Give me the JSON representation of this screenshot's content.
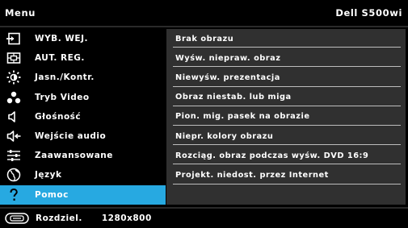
{
  "header": {
    "title": "Menu",
    "model": "Dell S500wi"
  },
  "menu": {
    "items": [
      {
        "label": "WYB. WEJ.",
        "icon": "input-source-icon"
      },
      {
        "label": "AUT. REG.",
        "icon": "auto-adjust-icon"
      },
      {
        "label": "Jasn./Kontr.",
        "icon": "brightness-icon"
      },
      {
        "label": "Tryb Video",
        "icon": "video-mode-icon"
      },
      {
        "label": "Głośność",
        "icon": "volume-icon"
      },
      {
        "label": "Wejście audio",
        "icon": "audio-input-icon"
      },
      {
        "label": "Zaawansowane",
        "icon": "advanced-settings-icon"
      },
      {
        "label": "Język",
        "icon": "language-globe-icon"
      },
      {
        "label": "Pomoc",
        "icon": "help-icon",
        "selected": true
      }
    ]
  },
  "help": {
    "items": [
      "Brak obrazu",
      "Wyśw. niepraw. obraz",
      "Niewyśw. prezentacja",
      "Obraz niestab. lub miga",
      "Pion. mig. pasek na obrazie",
      "Niepr. kolory obrazu",
      "Rozciąg. obraz podczas wyśw. DVD 16:9",
      "Projekt. niedost. przez Internet"
    ]
  },
  "footer": {
    "label": "Rozdziel.",
    "value": "1280x800",
    "icon": "resolution-icon"
  },
  "colors": {
    "selected": "#27a9e1",
    "panel": "#303030",
    "background": "#000000"
  }
}
